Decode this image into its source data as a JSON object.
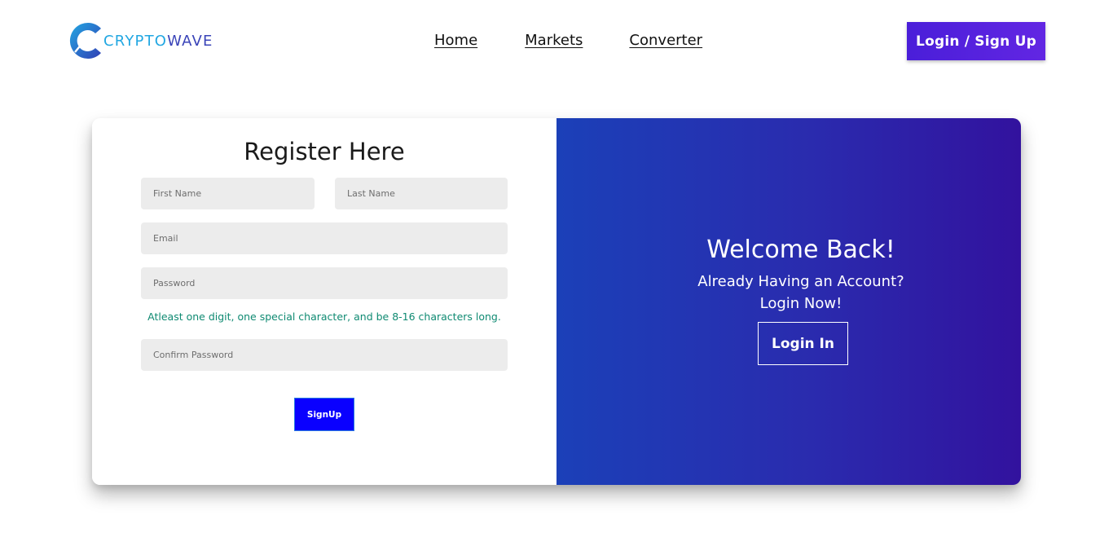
{
  "brand": {
    "logo_text_part1": "CRYPTO",
    "logo_text_part2": "WAVE",
    "colors": {
      "primary_blue": "#22a7e2",
      "dark_blue": "#3a44b8"
    }
  },
  "nav": {
    "items": [
      {
        "label": "Home"
      },
      {
        "label": "Markets"
      },
      {
        "label": "Converter"
      }
    ],
    "login_signup_label": "Login / Sign Up"
  },
  "register": {
    "title": "Register Here",
    "first_name_placeholder": "First Name",
    "last_name_placeholder": "Last Name",
    "email_placeholder": "Email",
    "password_placeholder": "Password",
    "password_hint": "Atleast one digit, one special character, and be 8-16 characters long.",
    "confirm_password_placeholder": "Confirm Password",
    "signup_label": "SignUp"
  },
  "welcome": {
    "title": "Welcome Back!",
    "line1": "Already Having an Account?",
    "line2": "Login Now!",
    "login_label": "Login In"
  },
  "colors": {
    "signup_button": "#0a00ff",
    "hint_text": "#0f8a72",
    "panel_gradient_start": "#1b40b8",
    "panel_gradient_end": "#32129e",
    "header_button": "#4a1ed9"
  }
}
